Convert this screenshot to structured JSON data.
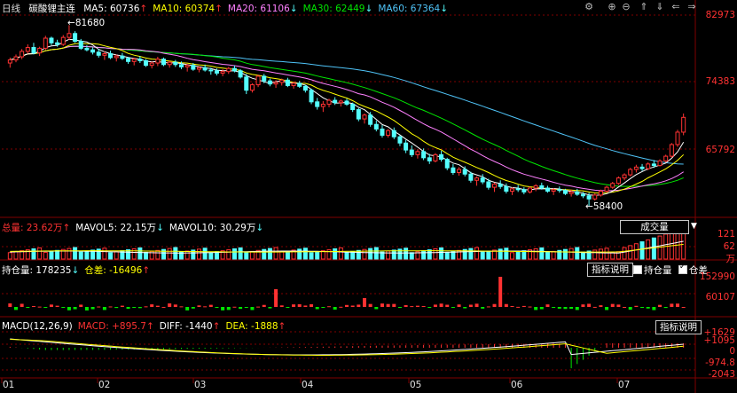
{
  "period": "日线",
  "instrument": "碳酸锂主连",
  "colors": {
    "up": "#ff3232",
    "down": "#54ffff",
    "ma5": "#ffffff",
    "ma10": "#ffff00",
    "ma20": "#ff80ff",
    "ma30": "#00e600",
    "ma60": "#4fc3f7",
    "grid": "#7f0000",
    "text": "#ff3232"
  },
  "ma_legend": [
    {
      "label": "MA5: 60736",
      "arrow": "↑",
      "color": "#ffffff"
    },
    {
      "label": "MA10: 60374",
      "arrow": "↑",
      "color": "#ffff00"
    },
    {
      "label": "MA20: 61106",
      "arrow": "↓",
      "color": "#ff80ff"
    },
    {
      "label": "MA30: 62449",
      "arrow": "↓",
      "color": "#00e600"
    },
    {
      "label": "MA60: 67364",
      "arrow": "↓",
      "color": "#4fc3f7"
    }
  ],
  "price_axis": {
    "labels": [
      "82973",
      "74383",
      "65792"
    ]
  },
  "annotations": {
    "high": "81680",
    "low": "58400"
  },
  "volume_legend": [
    {
      "label": "总量: 23.62万",
      "arrow": "↑",
      "color": "#ff3232"
    },
    {
      "label": "MAVOL5: 22.15万",
      "arrow": "↓",
      "color": "#ffffff"
    },
    {
      "label": "MAVOL10: 30.29万",
      "arrow": "↓",
      "color": "#ffffff"
    }
  ],
  "volume_axis": {
    "labels": [
      "121",
      "62",
      "万"
    ]
  },
  "volume_button": "成交量",
  "oi_legend": [
    {
      "label": "持仓量: 178235",
      "arrow": "↓",
      "color": "#ffffff"
    },
    {
      "label": "仓差: -16496",
      "arrow": "↑",
      "color": "#ffff00"
    }
  ],
  "oi_axis": {
    "labels": [
      "152990",
      "60107"
    ]
  },
  "oi_controls": {
    "explain": "指标说明",
    "chk1": "持仓量",
    "chk2": "仓差"
  },
  "macd_legend": [
    {
      "label": "MACD(12,26,9)",
      "arrow": "",
      "color": "#ffffff"
    },
    {
      "label": "MACD: +895.7",
      "arrow": "↑",
      "color": "#ff3232"
    },
    {
      "label": "DIFF: -1440",
      "arrow": "↑",
      "color": "#ffffff"
    },
    {
      "label": "DEA: -1888",
      "arrow": "↑",
      "color": "#ffff00"
    }
  ],
  "macd_axis": {
    "labels": [
      "+1629",
      "+1095",
      "0",
      "-974.8",
      "-2043"
    ]
  },
  "macd_button": "指标说明",
  "x_axis": {
    "labels": [
      "01",
      "02",
      "03",
      "04",
      "05",
      "06",
      "07"
    ]
  },
  "chart_data": {
    "type": "candlestick",
    "months": [
      "01",
      "02",
      "03",
      "04",
      "05",
      "06",
      "07"
    ],
    "candles": [
      [
        76800,
        77500,
        76200,
        77200
      ],
      [
        77200,
        77900,
        76900,
        77600
      ],
      [
        77600,
        78600,
        77300,
        78300
      ],
      [
        78300,
        79200,
        78000,
        78800
      ],
      [
        78800,
        79400,
        77900,
        78100
      ],
      [
        78100,
        78900,
        77700,
        78700
      ],
      [
        78700,
        80300,
        78500,
        80000
      ],
      [
        80000,
        80200,
        79100,
        79400
      ],
      [
        79400,
        79800,
        78900,
        79200
      ],
      [
        79200,
        80400,
        79000,
        80100
      ],
      [
        80100,
        81680,
        79800,
        80600
      ],
      [
        80600,
        80900,
        79400,
        79600
      ],
      [
        79600,
        79900,
        78500,
        78700
      ],
      [
        78700,
        79100,
        78300,
        78500
      ],
      [
        78500,
        78800,
        77900,
        78200
      ],
      [
        78200,
        78600,
        77500,
        77800
      ],
      [
        77800,
        78300,
        77200,
        78000
      ],
      [
        78000,
        78400,
        77300,
        77500
      ],
      [
        77500,
        77900,
        77000,
        77700
      ],
      [
        77700,
        78100,
        77200,
        77400
      ],
      [
        77400,
        77600,
        76700,
        77000
      ],
      [
        77000,
        77500,
        76500,
        77300
      ],
      [
        77300,
        77700,
        76800,
        77100
      ],
      [
        77100,
        77300,
        76300,
        76500
      ],
      [
        76500,
        77000,
        76100,
        76800
      ],
      [
        76800,
        77600,
        76400,
        77300
      ],
      [
        77300,
        77500,
        76400,
        76600
      ],
      [
        76600,
        77100,
        76200,
        76900
      ],
      [
        76900,
        77200,
        76300,
        76600
      ],
      [
        76600,
        77000,
        76000,
        76300
      ],
      [
        76300,
        76700,
        75700,
        76500
      ],
      [
        76500,
        76800,
        75800,
        76000
      ],
      [
        76000,
        76400,
        75600,
        76200
      ],
      [
        76200,
        76600,
        75700,
        75900
      ],
      [
        75900,
        76200,
        75300,
        75800
      ],
      [
        75800,
        76100,
        75200,
        75500
      ],
      [
        75500,
        76000,
        75100,
        75700
      ],
      [
        75700,
        76300,
        75400,
        76100
      ],
      [
        76100,
        76500,
        75600,
        75800
      ],
      [
        75800,
        76000,
        74800,
        75000
      ],
      [
        75000,
        75400,
        72800,
        73300
      ],
      [
        73300,
        74200,
        73000,
        74000
      ],
      [
        74000,
        75300,
        73700,
        75100
      ],
      [
        75100,
        75400,
        74200,
        74500
      ],
      [
        74500,
        74800,
        73800,
        74100
      ],
      [
        74100,
        74600,
        73600,
        74300
      ],
      [
        74300,
        74800,
        73900,
        74600
      ],
      [
        74600,
        74900,
        73700,
        73900
      ],
      [
        73900,
        74400,
        73500,
        74200
      ],
      [
        74200,
        74500,
        73600,
        73800
      ],
      [
        73800,
        74000,
        73000,
        73300
      ],
      [
        73300,
        73500,
        71500,
        71800
      ],
      [
        71800,
        72300,
        70800,
        71200
      ],
      [
        71200,
        71900,
        70500,
        71500
      ],
      [
        71500,
        72200,
        71100,
        72000
      ],
      [
        72000,
        72400,
        71400,
        71700
      ],
      [
        71700,
        72100,
        71200,
        71900
      ],
      [
        71900,
        72200,
        71300,
        71500
      ],
      [
        71500,
        71700,
        70500,
        70800
      ],
      [
        70800,
        71000,
        69300,
        69600
      ],
      [
        69600,
        70300,
        69000,
        70100
      ],
      [
        70100,
        70500,
        68600,
        68900
      ],
      [
        68900,
        69400,
        68000,
        68300
      ],
      [
        68300,
        68800,
        67200,
        67500
      ],
      [
        67500,
        68300,
        67200,
        68100
      ],
      [
        68100,
        68500,
        67000,
        67300
      ],
      [
        67300,
        67500,
        66100,
        66500
      ],
      [
        66500,
        66900,
        65200,
        65600
      ],
      [
        65600,
        66200,
        64700,
        65000
      ],
      [
        65000,
        65700,
        64500,
        65400
      ],
      [
        65400,
        65800,
        64300,
        64600
      ],
      [
        64600,
        65100,
        63800,
        64200
      ],
      [
        64200,
        65200,
        64000,
        65000
      ],
      [
        65000,
        65500,
        64100,
        64400
      ],
      [
        64400,
        64600,
        63000,
        63300
      ],
      [
        63300,
        63800,
        62400,
        62700
      ],
      [
        62700,
        63400,
        62300,
        63100
      ],
      [
        63100,
        63500,
        62200,
        62500
      ],
      [
        62500,
        62800,
        61400,
        61700
      ],
      [
        61700,
        62200,
        61000,
        62000
      ],
      [
        62000,
        62500,
        61200,
        61500
      ],
      [
        61500,
        61900,
        60500,
        60800
      ],
      [
        60800,
        61400,
        60200,
        61200
      ],
      [
        61200,
        61700,
        60600,
        60900
      ],
      [
        60900,
        61300,
        60000,
        60300
      ],
      [
        60300,
        60800,
        59800,
        60600
      ],
      [
        60600,
        61100,
        60200,
        60500
      ],
      [
        60500,
        60800,
        59900,
        60200
      ],
      [
        60200,
        60900,
        60000,
        60700
      ],
      [
        60700,
        61200,
        60300,
        61000
      ],
      [
        61000,
        61400,
        60500,
        60700
      ],
      [
        60700,
        61000,
        60100,
        60300
      ],
      [
        60300,
        60700,
        59800,
        60500
      ],
      [
        60500,
        60900,
        60100,
        60400
      ],
      [
        60400,
        60600,
        59800,
        60000
      ],
      [
        60000,
        60500,
        59600,
        60200
      ],
      [
        60200,
        60600,
        59700,
        59900
      ],
      [
        59900,
        60200,
        59400,
        59700
      ],
      [
        59700,
        60100,
        58400,
        59300
      ],
      [
        59300,
        60000,
        59100,
        59800
      ],
      [
        59800,
        60500,
        59600,
        60300
      ],
      [
        60300,
        61000,
        60100,
        60800
      ],
      [
        60800,
        61500,
        60600,
        61300
      ],
      [
        61300,
        62200,
        61100,
        62000
      ],
      [
        62000,
        62600,
        61700,
        62400
      ],
      [
        62400,
        63300,
        62200,
        63100
      ],
      [
        63100,
        63700,
        62700,
        63400
      ],
      [
        63400,
        63800,
        62900,
        63200
      ],
      [
        63200,
        64000,
        63000,
        63800
      ],
      [
        63800,
        64300,
        63300,
        63600
      ],
      [
        63600,
        64400,
        63500,
        64200
      ],
      [
        64200,
        65000,
        64000,
        64800
      ],
      [
        64800,
        66500,
        64600,
        66300
      ],
      [
        66300,
        68200,
        66000,
        67900
      ],
      [
        67900,
        70300,
        67500,
        69800
      ]
    ],
    "volume_unit": "万",
    "open_interest_note": "持仓量 and 仓差 bars",
    "macd": {
      "diff": -1440,
      "dea": -1888,
      "macd": 895.7
    }
  }
}
